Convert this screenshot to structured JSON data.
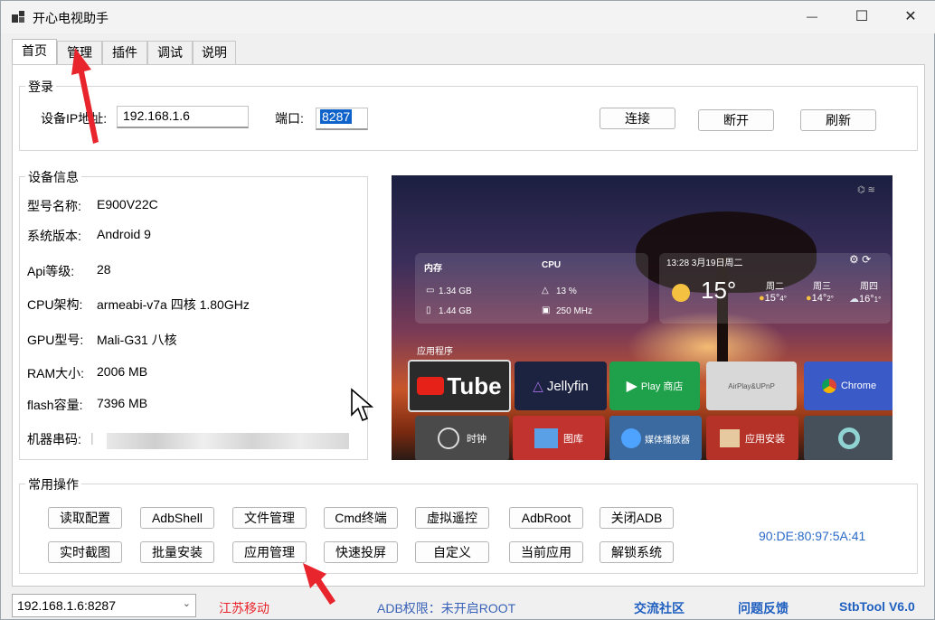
{
  "window": {
    "title": "开心电视助手",
    "minimize_glyph": "—",
    "maximize_glyph": "☐",
    "close_glyph": "✕"
  },
  "tabs": [
    {
      "label": "首页"
    },
    {
      "label": "管理"
    },
    {
      "label": "插件"
    },
    {
      "label": "调试"
    },
    {
      "label": "说明"
    }
  ],
  "login": {
    "group_title": "登录",
    "ip_label": "设备IP地址:",
    "ip_value": "192.168.1.6",
    "port_label": "端口:",
    "port_value": "8287",
    "connect_label": "连接",
    "disconnect_label": "断开",
    "refresh_label": "刷新"
  },
  "device_info": {
    "group_title": "设备信息",
    "rows": [
      {
        "label": "型号名称:",
        "value": "E900V22C"
      },
      {
        "label": "系统版本:",
        "value": "Android 9"
      },
      {
        "label": "Api等级:",
        "value": "28"
      },
      {
        "label": "CPU架构:",
        "value": "armeabi-v7a 四核 1.80GHz"
      },
      {
        "label": "GPU型号:",
        "value": "Mali-G31 八核"
      },
      {
        "label": "RAM大小:",
        "value": "2006 MB"
      },
      {
        "label": "flash容量:",
        "value": "7396 MB"
      },
      {
        "label": "机器串码:",
        "value": ""
      }
    ]
  },
  "tv_screen": {
    "memory_title": "内存",
    "mem1": "1.34 GB",
    "mem2": "1.44 GB",
    "cpu_title": "CPU",
    "cpu1": "13 %",
    "cpu2": "250 MHz",
    "datetime": "13:28 3月19日周二",
    "temp_now": "15°",
    "forecast": [
      {
        "day": "周二",
        "temp": "15°",
        "low": "4°"
      },
      {
        "day": "周三",
        "temp": "14°",
        "low": "2°"
      },
      {
        "day": "周四",
        "temp": "16°",
        "low": "1°"
      }
    ],
    "apps_title": "应用程序",
    "apps_row1": [
      "Tube",
      "Jellyfin",
      "Play 商店",
      "AirPlay&UPnP",
      "Chrome"
    ],
    "apps_row2": [
      "时钟",
      "图库",
      "媒体播放器",
      "应用安装",
      ""
    ]
  },
  "common_ops": {
    "group_title": "常用操作",
    "row1": [
      "读取配置",
      "AdbShell",
      "文件管理",
      "Cmd终端",
      "虚拟遥控",
      "AdbRoot",
      "关闭ADB"
    ],
    "row2": [
      "实时截图",
      "批量安装",
      "应用管理",
      "快速投屏",
      "自定义",
      "当前应用",
      "解锁系统"
    ],
    "mac": "90:DE:80:97:5A:41"
  },
  "status": {
    "combo_value": "192.168.1.6:8287",
    "isp": "江苏移动",
    "adb_perm": "ADB权限：未开启ROOT",
    "community": "交流社区",
    "feedback": "问题反馈",
    "version": "StbTool V6.0"
  },
  "colors": {
    "accent_red": "#e8242c",
    "link_blue": "#1f5fbf",
    "mac_blue": "#2a6ac8"
  }
}
